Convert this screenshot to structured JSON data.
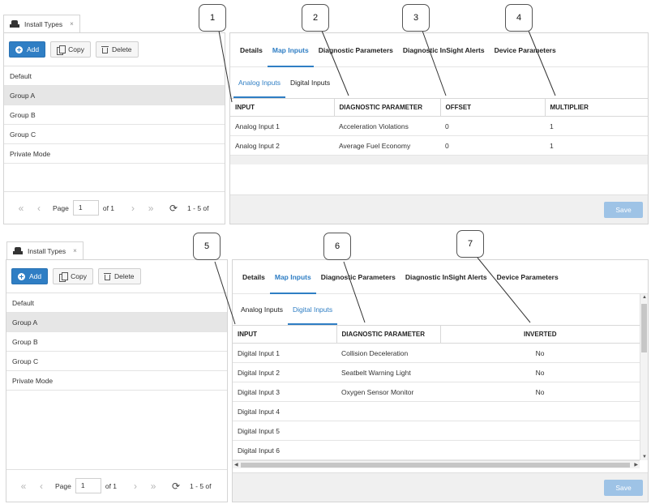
{
  "panel1": {
    "window_tab": {
      "label": "Install Types",
      "close": "×"
    },
    "toolbar": {
      "add": "Add",
      "copy": "Copy",
      "delete": "Delete"
    },
    "list": [
      "Default",
      "Group A",
      "Group B",
      "Group C",
      "Private Mode"
    ],
    "selected_index": 1,
    "pager": {
      "page_label": "Page",
      "page_value": "1",
      "of_label": "of 1",
      "range": "1 - 5 of"
    },
    "tabs": [
      "Details",
      "Map Inputs",
      "Diagnostic Parameters",
      "Diagnostic InSight Alerts",
      "Device Parameters"
    ],
    "active_tab": "Map Inputs",
    "subtabs": [
      "Analog Inputs",
      "Digital Inputs"
    ],
    "active_subtab": "Analog Inputs",
    "columns": [
      "INPUT",
      "DIAGNOSTIC PARAMETER",
      "OFFSET",
      "MULTIPLIER"
    ],
    "rows": [
      [
        "Analog Input 1",
        "Acceleration Violations",
        "0",
        "1"
      ],
      [
        "Analog Input 2",
        "Average Fuel Economy",
        "0",
        "1"
      ]
    ],
    "save": "Save"
  },
  "panel2": {
    "window_tab": {
      "label": "Install Types",
      "close": "×"
    },
    "toolbar": {
      "add": "Add",
      "copy": "Copy",
      "delete": "Delete"
    },
    "list": [
      "Default",
      "Group A",
      "Group B",
      "Group C",
      "Private Mode"
    ],
    "selected_index": 1,
    "pager": {
      "page_label": "Page",
      "page_value": "1",
      "of_label": "of 1",
      "range": "1 - 5 of"
    },
    "tabs": [
      "Details",
      "Map Inputs",
      "Diagnostic Parameters",
      "Diagnostic InSight Alerts",
      "Device Parameters"
    ],
    "active_tab": "Map Inputs",
    "subtabs": [
      "Analog Inputs",
      "Digital Inputs"
    ],
    "active_subtab": "Digital Inputs",
    "columns": [
      "INPUT",
      "DIAGNOSTIC PARAMETER",
      "INVERTED"
    ],
    "rows": [
      [
        "Digital Input 1",
        "Collision Deceleration",
        "No"
      ],
      [
        "Digital Input 2",
        "Seatbelt Warning Light",
        "No"
      ],
      [
        "Digital Input 3",
        "Oxygen Sensor Monitor",
        "No"
      ],
      [
        "Digital Input 4",
        "",
        ""
      ],
      [
        "Digital Input 5",
        "",
        ""
      ],
      [
        "Digital Input 6",
        "",
        ""
      ]
    ],
    "save": "Save"
  },
  "callouts": [
    "1",
    "2",
    "3",
    "4",
    "5",
    "6",
    "7"
  ],
  "colors": {
    "accent": "#2f7ec4",
    "save_disabled": "#9ec3e6",
    "selected_row": "#e6e6e6"
  },
  "icons": {
    "tab": "install-types-icon",
    "add": "plus-circle-icon",
    "copy": "copy-icon",
    "delete": "trash-icon",
    "first": "double-chevron-left-icon",
    "prev": "chevron-left-icon",
    "next": "chevron-right-icon",
    "last": "double-chevron-right-icon",
    "refresh": "refresh-icon"
  }
}
